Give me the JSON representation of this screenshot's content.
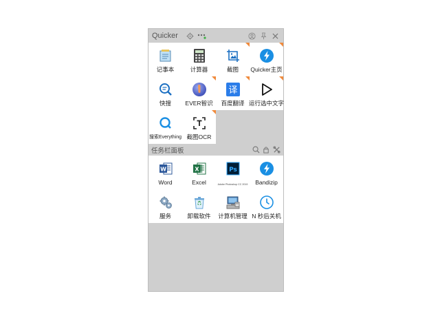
{
  "window": {
    "title": "Quicker"
  },
  "top_grid": [
    {
      "label": "记事本",
      "icon": "notepad-icon",
      "badge": false
    },
    {
      "label": "计算器",
      "icon": "calculator-icon",
      "badge": false
    },
    {
      "label": "截图",
      "icon": "screenshot-icon",
      "badge": true
    },
    {
      "label": "Quicker主页",
      "icon": "quicker-home-icon",
      "badge": true
    },
    {
      "label": "快搜",
      "icon": "quick-search-icon",
      "badge": false
    },
    {
      "label": "EVER智识",
      "icon": "ever-icon",
      "badge": true
    },
    {
      "label": "百度翻译",
      "icon": "translate-icon",
      "badge": true
    },
    {
      "label": "运行选中文字",
      "icon": "run-text-icon",
      "badge": true
    },
    {
      "label": "搜索Everything",
      "icon": "everything-search-icon",
      "badge": false
    },
    {
      "label": "截图OCR",
      "icon": "ocr-icon",
      "badge": true
    }
  ],
  "taskbar_section": {
    "title": "任务栏面板"
  },
  "bottom_grid": [
    {
      "label": "Word",
      "icon": "word-icon"
    },
    {
      "label": "Excel",
      "icon": "excel-icon"
    },
    {
      "label": "Adobe Photoshop CC 2019",
      "icon": "photoshop-icon"
    },
    {
      "label": "Bandizip",
      "icon": "bandizip-icon"
    },
    {
      "label": "服务",
      "icon": "services-icon"
    },
    {
      "label": "卸载软件",
      "icon": "uninstall-icon"
    },
    {
      "label": "计算机管理",
      "icon": "computer-management-icon"
    },
    {
      "label": "N 秒后关机",
      "icon": "shutdown-timer-icon"
    }
  ],
  "colors": {
    "badge": "#f08a3c",
    "accent": "#1a8fe3",
    "panel_bg": "#cfcfcf"
  }
}
